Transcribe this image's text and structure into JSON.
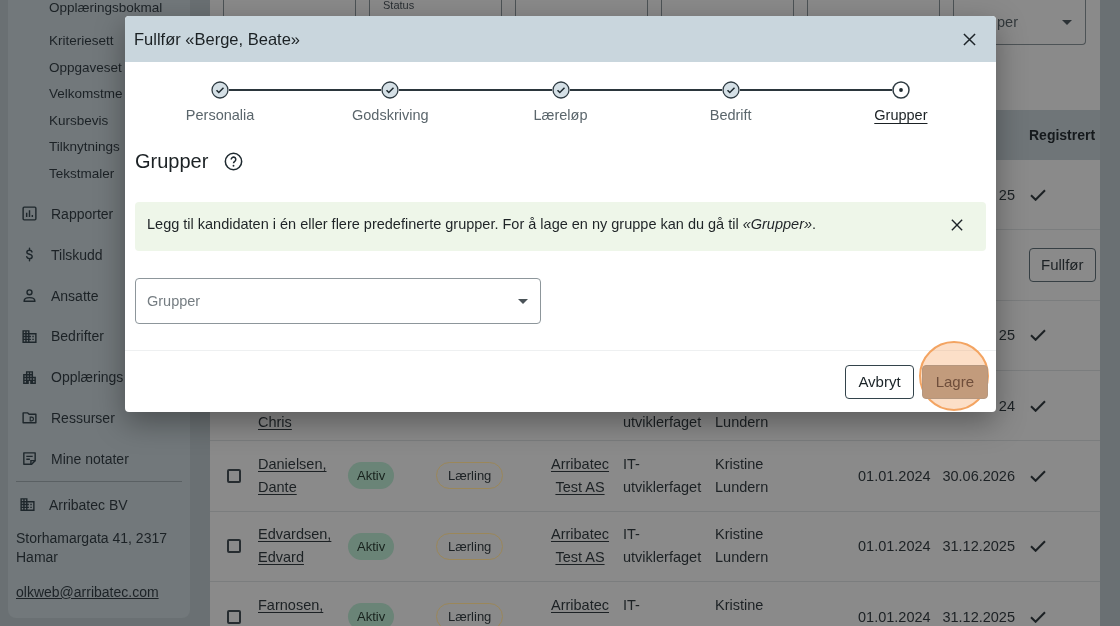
{
  "sidebar": {
    "subitems": [
      "Opplæringsbokmal",
      "Kriteriesett",
      "Oppgaveset",
      "Velkomstme",
      "Kursbevis",
      "Tilknytnings",
      "Tekstmaler"
    ],
    "items": [
      "Rapporter",
      "Tilskudd",
      "Ansatte",
      "Bedrifter",
      "Opplærings",
      "Ressurser",
      "Mine notater"
    ],
    "organization": {
      "name": "Arribatec BV",
      "address": "Storhamargata 41, 2317 Hamar",
      "email": "olkweb@arribatec.com"
    }
  },
  "filters": [
    {
      "kind": "field"
    },
    {
      "kind": "field",
      "label": "Status"
    },
    {
      "kind": "field"
    },
    {
      "kind": "field"
    },
    {
      "kind": "field"
    },
    {
      "kind": "select",
      "text": "per"
    }
  ],
  "table": {
    "header": {
      "registered": "Registrert"
    },
    "rows": [
      {
        "end": "25",
        "registered": true
      },
      {
        "registered": false,
        "action": "Fullfør"
      },
      {
        "end": "25",
        "registered": true
      },
      {
        "clipped_top": true,
        "name": "Chris",
        "subject": "utviklerfaget",
        "contact": "Lundern",
        "end": "24",
        "registered": true
      },
      {
        "checked": false,
        "name": "Danielsen, Dante",
        "status": "Aktiv",
        "role": "Lærling",
        "company": "Arribatec Test AS",
        "subject": "IT-utviklerfaget",
        "contact": "Kristine Lundern",
        "start": "01.01.2024",
        "end": "30.06.2026",
        "registered": true
      },
      {
        "checked": false,
        "name": "Edvardsen, Edvard",
        "status": "Aktiv",
        "role": "Lærling",
        "company": "Arribatec Test AS",
        "subject": "IT-utviklerfaget",
        "contact": "Kristine Lundern",
        "start": "01.01.2024",
        "end": "31.12.2025",
        "registered": true
      },
      {
        "checked": false,
        "name": "Farnosen,",
        "status": "Aktiv",
        "role": "Lærling",
        "company": "Arribatec",
        "subject": "IT-",
        "contact": "Kristine",
        "start": "01.01.2024",
        "end": "31.12.2025",
        "registered": true
      }
    ]
  },
  "dialog": {
    "title": "Fullfør «Berge, Beate»",
    "steps": [
      {
        "label": "Personalia",
        "completed": true,
        "selected": false
      },
      {
        "label": "Godskriving",
        "completed": true,
        "selected": false
      },
      {
        "label": "Læreløp",
        "completed": true,
        "selected": false
      },
      {
        "label": "Bedrift",
        "completed": true,
        "selected": false
      },
      {
        "label": "Grupper",
        "completed": false,
        "selected": true
      }
    ],
    "heading": "Grupper",
    "alert": "Legg til kandidaten i én eller flere predefinerte grupper. For å lage en ny gruppe kan du gå til *«Grupper»*.",
    "select": {
      "placeholder": "Grupper"
    },
    "buttons": [
      {
        "label": "Avbryt",
        "kind": "secondary",
        "highlighted": false
      },
      {
        "label": "Lagre",
        "kind": "primary",
        "highlighted": true
      }
    ]
  }
}
